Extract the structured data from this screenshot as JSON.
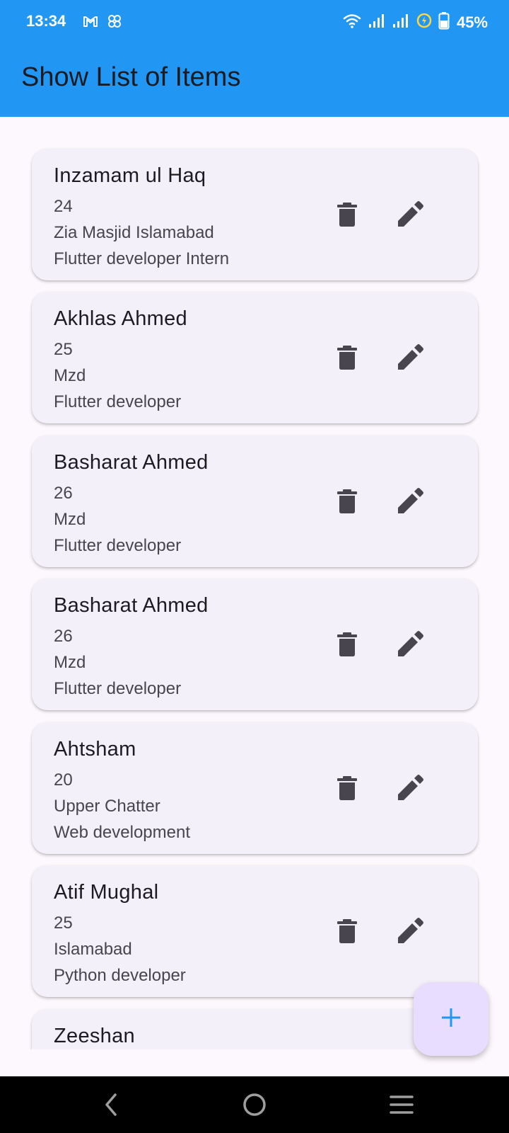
{
  "status_bar": {
    "time": "13:34",
    "battery_percent": "45%",
    "left_icons": [
      "gmail-icon",
      "pinwheel-icon"
    ],
    "right_icons": [
      "wifi-icon",
      "signal-icon",
      "signal-icon",
      "data-saver-icon",
      "battery-icon"
    ]
  },
  "appbar": {
    "title": "Show List of Items"
  },
  "colors": {
    "accent": "#2196f3",
    "card": "#f4f0fa",
    "fab": "#e9ddff",
    "icon": "#49454f"
  },
  "items": [
    {
      "name": "Inzamam ul Haq",
      "age": "24",
      "address": "Zia Masjid Islamabad",
      "role": "Flutter developer Intern"
    },
    {
      "name": "Akhlas Ahmed",
      "age": "25",
      "address": "Mzd",
      "role": "Flutter developer"
    },
    {
      "name": "Basharat Ahmed",
      "age": "26",
      "address": "Mzd",
      "role": "Flutter developer"
    },
    {
      "name": "Basharat Ahmed",
      "age": "26",
      "address": "Mzd",
      "role": "Flutter developer"
    },
    {
      "name": "Ahtsham",
      "age": "20",
      "address": "Upper Chatter",
      "role": "Web development"
    },
    {
      "name": "Atif Mughal",
      "age": "25",
      "address": "Islamabad",
      "role": "Python developer"
    },
    {
      "name": "Zeeshan",
      "age": "",
      "address": "",
      "role": ""
    }
  ],
  "item_actions": {
    "delete_icon": "delete-icon",
    "edit_icon": "edit-icon"
  },
  "fab": {
    "icon": "add-icon"
  },
  "nav_bar": {
    "icons": [
      "back-icon",
      "home-icon",
      "recents-icon"
    ]
  }
}
